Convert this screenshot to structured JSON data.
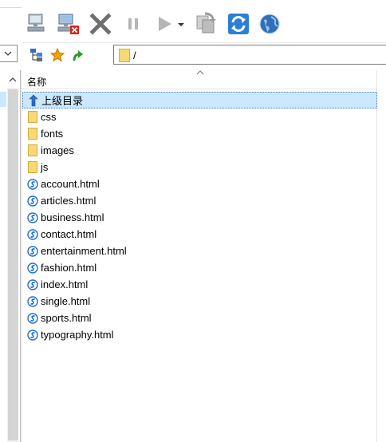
{
  "address": {
    "path": "/"
  },
  "file_list": {
    "column_header": "名称",
    "rows": [
      {
        "name": "上级目录",
        "type": "parent",
        "selected": true
      },
      {
        "name": "css",
        "type": "folder"
      },
      {
        "name": "fonts",
        "type": "folder"
      },
      {
        "name": "images",
        "type": "folder"
      },
      {
        "name": "js",
        "type": "folder"
      },
      {
        "name": "account.html",
        "type": "html"
      },
      {
        "name": "articles.html",
        "type": "html"
      },
      {
        "name": "business.html",
        "type": "html"
      },
      {
        "name": "contact.html",
        "type": "html"
      },
      {
        "name": "entertainment.html",
        "type": "html"
      },
      {
        "name": "fashion.html",
        "type": "html"
      },
      {
        "name": "index.html",
        "type": "html"
      },
      {
        "name": "single.html",
        "type": "html"
      },
      {
        "name": "sports.html",
        "type": "html"
      },
      {
        "name": "typography.html",
        "type": "html"
      }
    ]
  },
  "toolbar": {
    "buttons": [
      "connect-icon",
      "disconnect-icon",
      "cancel-icon",
      "pause-icon",
      "play-icon",
      "play-dropdown-icon",
      "queue-icon",
      "refresh-icon",
      "web-icon"
    ]
  },
  "colors": {
    "selection": "#cce8ff",
    "folder": "#f8d775",
    "accent_blue": "#1f6fd0"
  }
}
